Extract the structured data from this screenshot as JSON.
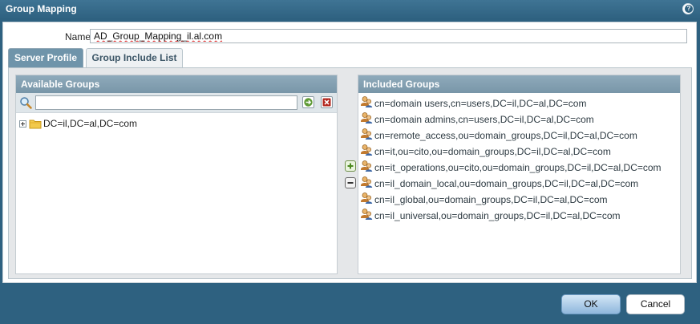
{
  "dialog": {
    "title": "Group Mapping"
  },
  "form": {
    "name_label": "Name",
    "name_value": "AD_Group_Mapping_il.al.com"
  },
  "tabs": [
    {
      "label": "Server Profile",
      "active": false
    },
    {
      "label": "Group Include List",
      "active": true
    }
  ],
  "available": {
    "header": "Available Groups",
    "search_value": "",
    "tree": [
      {
        "label": "DC=il,DC=al,DC=com",
        "expanded": false
      }
    ]
  },
  "included": {
    "header": "Included Groups",
    "items": [
      {
        "label": "cn=domain users,cn=users,DC=il,DC=al,DC=com"
      },
      {
        "label": "cn=domain admins,cn=users,DC=il,DC=al,DC=com"
      },
      {
        "label": "cn=remote_access,ou=domain_groups,DC=il,DC=al,DC=com"
      },
      {
        "label": "cn=it,ou=cito,ou=domain_groups,DC=il,DC=al,DC=com"
      },
      {
        "label": "cn=it_operations,ou=cito,ou=domain_groups,DC=il,DC=al,DC=com"
      },
      {
        "label": "cn=il_domain_local,ou=domain_groups,DC=il,DC=al,DC=com"
      },
      {
        "label": "cn=il_global,ou=domain_groups,DC=il,DC=al,DC=com"
      },
      {
        "label": "cn=il_universal,ou=domain_groups,DC=il,DC=al,DC=com"
      }
    ]
  },
  "footer": {
    "ok_label": "OK",
    "cancel_label": "Cancel"
  },
  "colors": {
    "titlebar": "#2e6180",
    "panel_header": "#7f9db0",
    "ok_button": "#a7c8e6"
  }
}
